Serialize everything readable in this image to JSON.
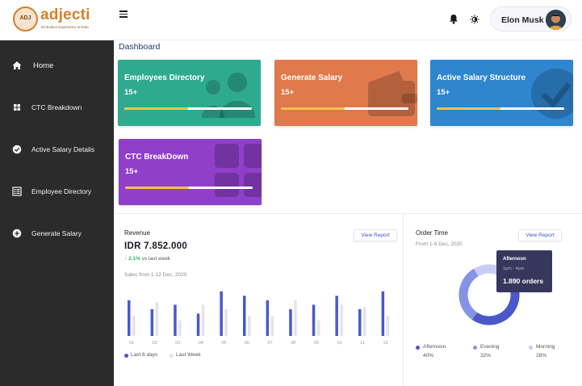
{
  "brand": {
    "logo_text": "ADJ",
    "name": "adjecti",
    "tagline": "Embodies Experience & Data"
  },
  "sidebar": {
    "items": [
      {
        "label": "Home",
        "icon": "home-icon"
      },
      {
        "label": "CTC Breakdown",
        "icon": "grid-icon"
      },
      {
        "label": "Active Salary Details",
        "icon": "check-circle-icon"
      },
      {
        "label": "Employee Directory",
        "icon": "list-icon"
      },
      {
        "label": "Generate Salary",
        "icon": "plus-circle-icon"
      }
    ]
  },
  "header": {
    "user_name": "Elon Musk"
  },
  "page": {
    "title": "Dashboard"
  },
  "cards": [
    {
      "title": "Employees Directory",
      "value": "15+",
      "color": "#2eaa8f",
      "progress": 0.5
    },
    {
      "title": "Generate Salary",
      "value": "15+",
      "color": "#e07a4c",
      "progress": 0.5
    },
    {
      "title": "Active Salary Structure",
      "value": "15+",
      "color": "#2f86cf",
      "progress": 0.5
    },
    {
      "title": "CTC BreakDown",
      "value": "15+",
      "color": "#8f3fc9",
      "progress": 0.5
    }
  ],
  "revenue": {
    "label": "Revenue",
    "value": "IDR 7.852.000",
    "trend_pct": "2.1%",
    "trend_text": "vs last week",
    "sub": "Sales from 1-12 Dec, 2020",
    "button": "View Report"
  },
  "order_time": {
    "label": "Order Time",
    "sub": "From 1-6 Dec, 2020",
    "button": "View Report",
    "tooltip": {
      "title": "Afternoon",
      "time": "1pm - 4pm",
      "orders": "1.890 orders"
    },
    "legend": [
      {
        "name": "Afternoon",
        "pct": "40%",
        "color": "#4a58c9"
      },
      {
        "name": "Evening",
        "pct": "32%",
        "color": "#8593e6"
      },
      {
        "name": "Morning",
        "pct": "28%",
        "color": "#c9cdf5"
      }
    ]
  },
  "chart_data": [
    {
      "type": "bar",
      "categories": [
        "01",
        "02",
        "03",
        "04",
        "05",
        "06",
        "07",
        "08",
        "09",
        "10",
        "11",
        "12"
      ],
      "series": [
        {
          "name": "Last 6 days",
          "values": [
            8,
            6,
            7,
            5,
            10,
            9,
            8,
            6,
            7,
            9,
            6,
            10
          ],
          "color": "#4a58c9"
        },
        {
          "name": "Last Week",
          "values": [
            4.5,
            7.5,
            3.5,
            7,
            6,
            4.5,
            4.5,
            8,
            3.5,
            7,
            6.5,
            4.5
          ],
          "color": "#e3e3ea"
        }
      ],
      "ylim": [
        0,
        10.5
      ],
      "grid": false,
      "legend": "bottom-left"
    },
    {
      "type": "pie",
      "categories": [
        "Afternoon",
        "Evening",
        "Morning"
      ],
      "values": [
        40,
        32,
        28
      ],
      "colors": [
        "#4a58c9",
        "#8593e6",
        "#c9cdf5"
      ],
      "donut": true
    }
  ]
}
